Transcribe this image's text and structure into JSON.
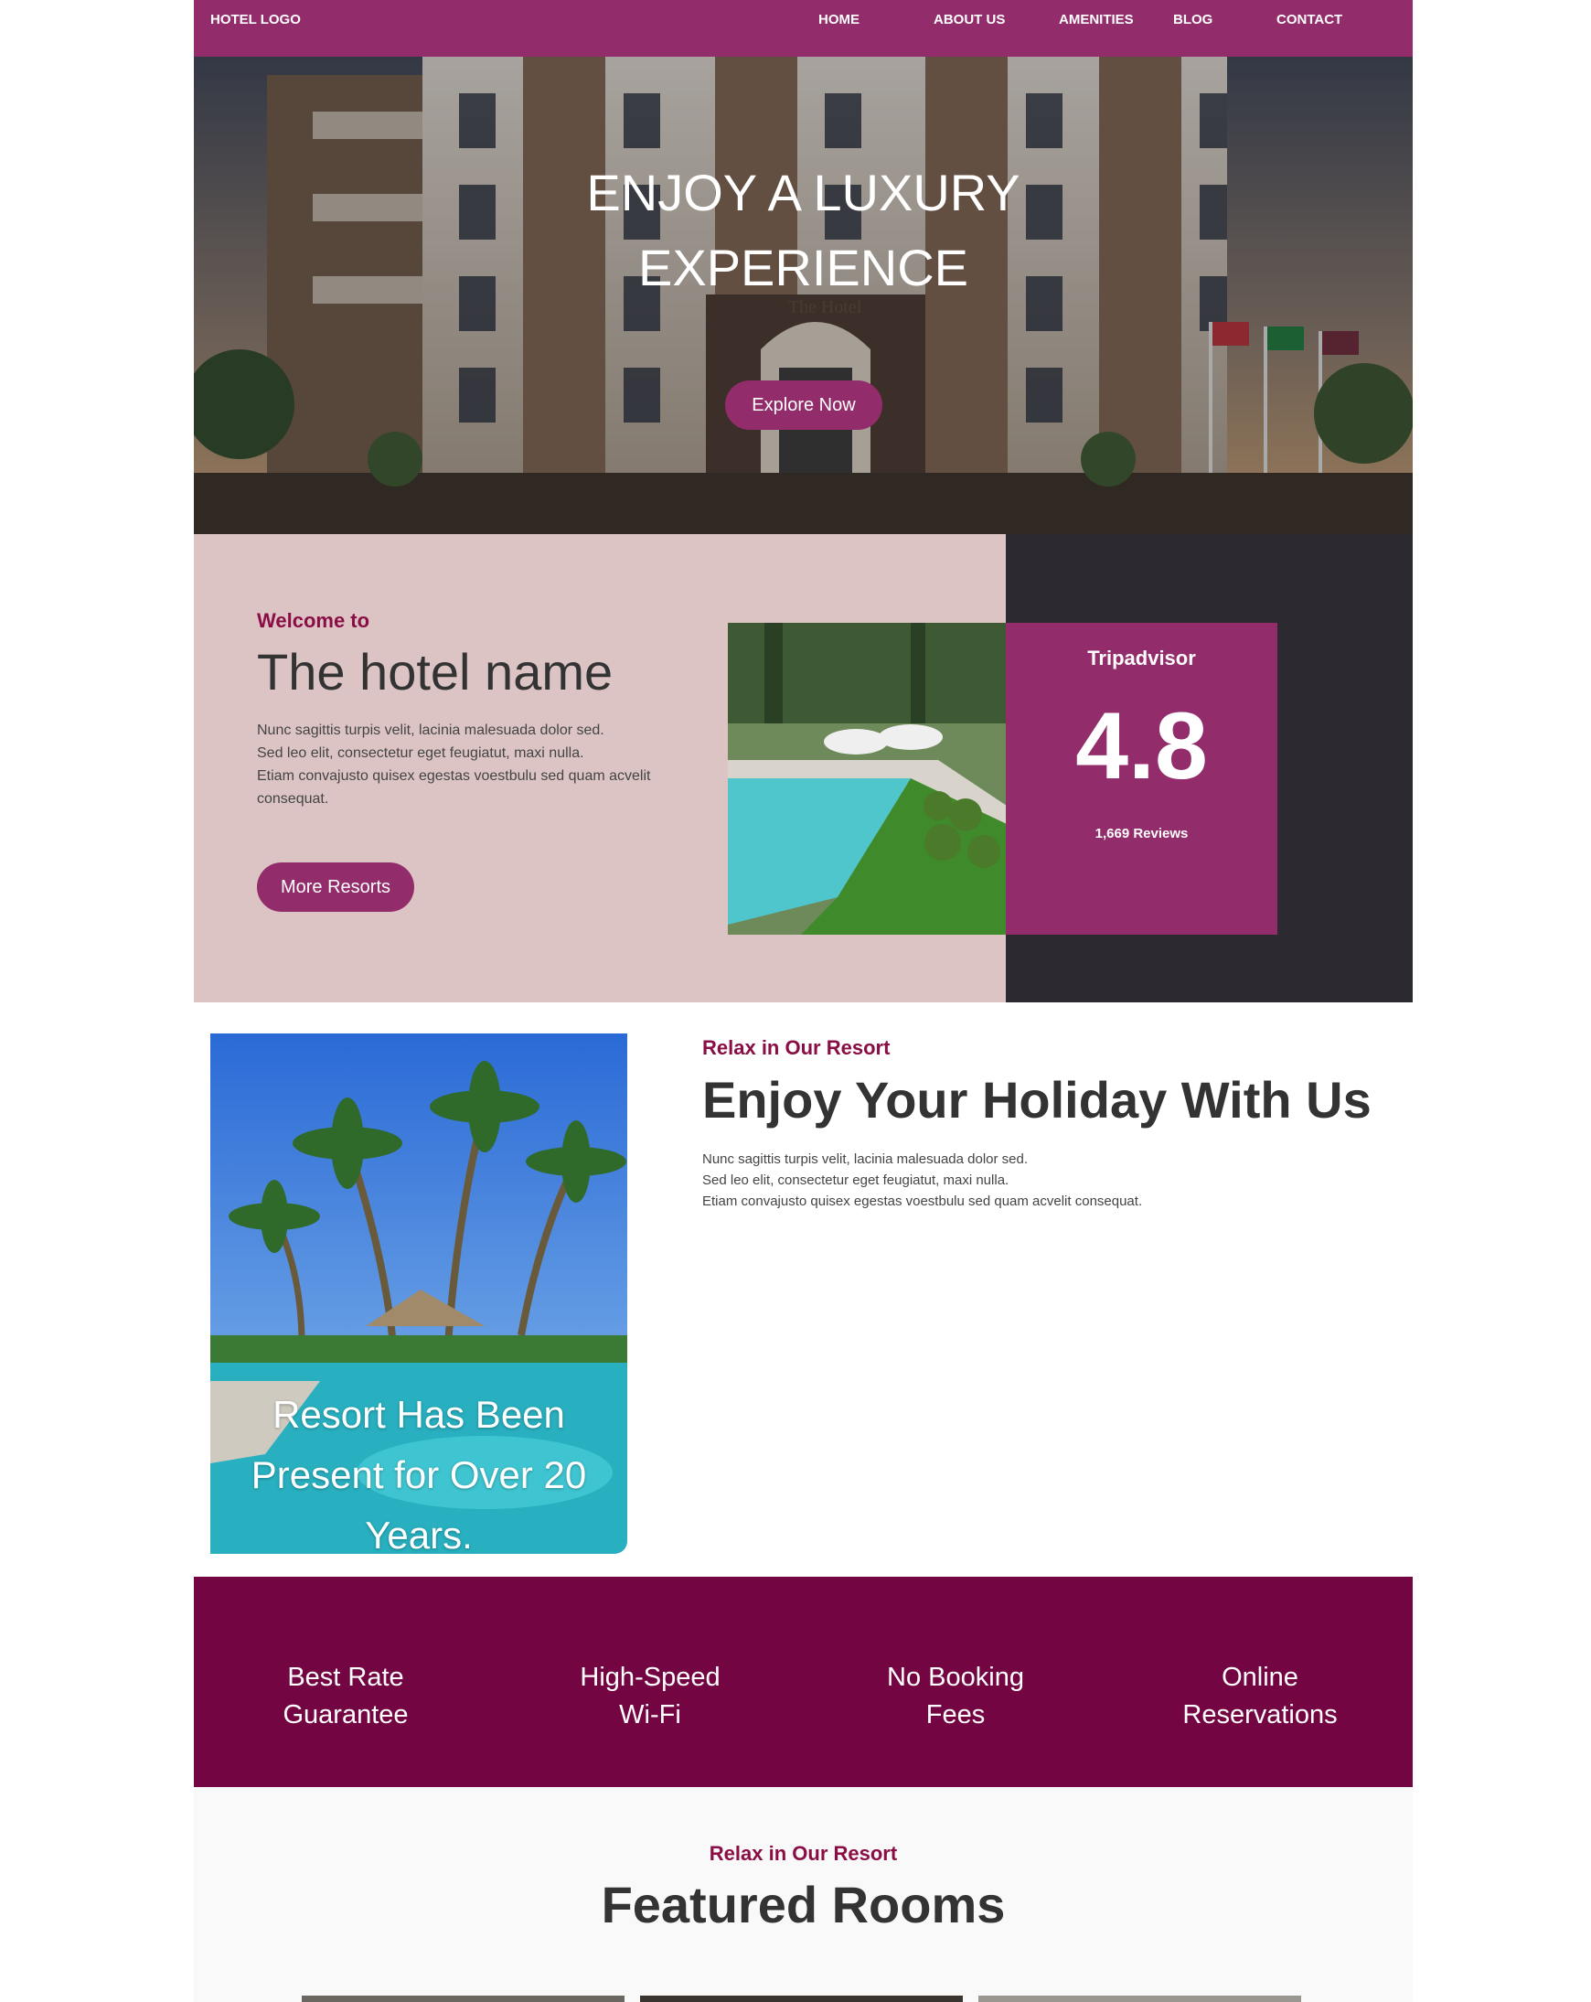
{
  "nav": {
    "logo": "HOTEL LOGO",
    "links": [
      "HOME",
      "ABOUT US",
      "AMENITIES",
      "BLOG",
      "CONTACT"
    ]
  },
  "hero": {
    "title_line1": "ENJOY A LUXURY",
    "title_line2": "EXPERIENCE",
    "cta": "Explore Now",
    "building_sign": "The Hotel"
  },
  "welcome": {
    "kicker": "Welcome to",
    "title": "The hotel name",
    "body_lines": [
      "Nunc sagittis turpis velit, lacinia malesuada dolor sed.",
      "Sed leo elit, consectetur eget feugiatut, maxi nulla.",
      "Etiam convajusto quisex egestas voestbulu sed quam acvelit consequat."
    ],
    "cta": "More Resorts",
    "rating": {
      "source": "Tripadvisor",
      "score": "4.8",
      "reviews": "1,669 Reviews"
    }
  },
  "holiday": {
    "kicker": "Relax in Our Resort",
    "title": "Enjoy Your Holiday With Us",
    "body_lines": [
      "Nunc sagittis turpis velit, lacinia malesuada dolor sed.",
      "Sed leo elit, consectetur eget feugiatut, maxi nulla.",
      "Etiam convajusto quisex egestas voestbulu sed quam acvelit consequat."
    ],
    "image_caption": "Resort Has Been Present for Over 20 Years."
  },
  "features": [
    {
      "line1": "Best Rate",
      "line2": "Guarantee"
    },
    {
      "line1": "High-Speed",
      "line2": "Wi-Fi"
    },
    {
      "line1": "No Booking",
      "line2": "Fees"
    },
    {
      "line1": "Online",
      "line2": "Reservations"
    }
  ],
  "rooms": {
    "kicker": "Relax in Our Resort",
    "title": "Featured Rooms"
  },
  "colors": {
    "brand": "#932c6b",
    "band": "#740543",
    "accent_text": "#8a0e45",
    "welcome_bg": "#dcc4c4",
    "dark_panel": "#2c2a30"
  }
}
